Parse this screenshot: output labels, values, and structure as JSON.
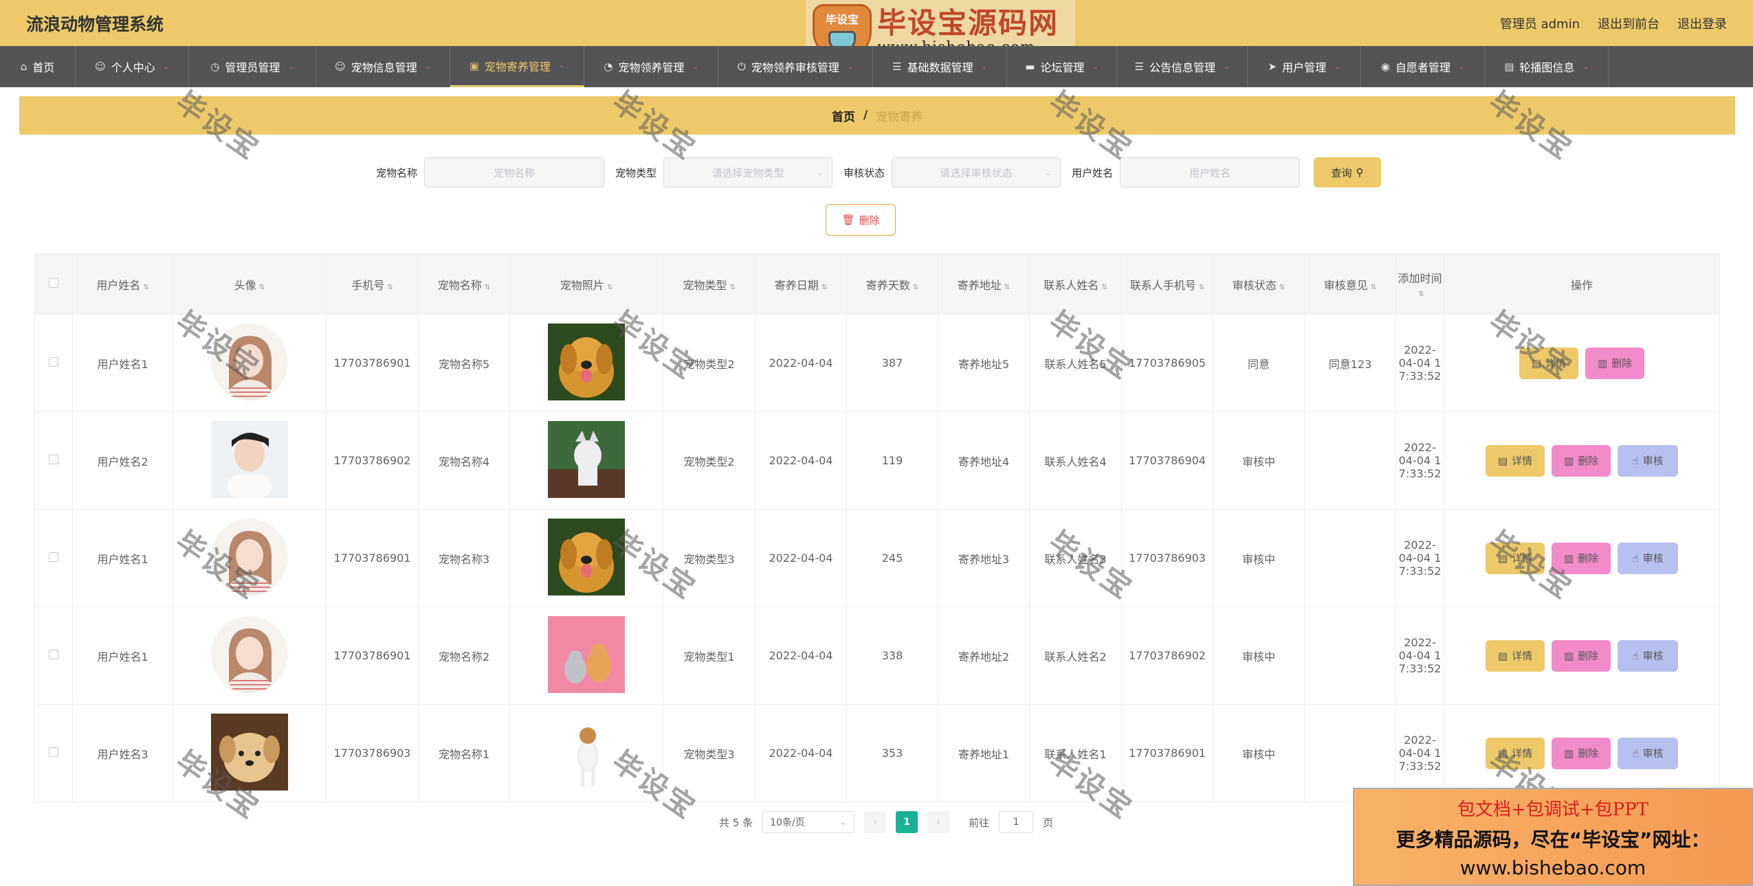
{
  "header": {
    "app_title": "流浪动物管理系统",
    "admin_label": "管理员 admin",
    "front_link": "退出到前台",
    "logout_link": "退出登录"
  },
  "logo_watermark": {
    "badge_text": "毕设宝",
    "title": "毕设宝源码网",
    "url": "www.bishebao.com"
  },
  "nav": {
    "items": [
      {
        "label": "首页",
        "icon": "home-icon"
      },
      {
        "label": "个人中心",
        "icon": "user-icon"
      },
      {
        "label": "管理员管理",
        "icon": "clock-icon"
      },
      {
        "label": "宠物信息管理",
        "icon": "user-icon"
      },
      {
        "label": "宠物寄养管理",
        "icon": "briefcase-icon",
        "active": true
      },
      {
        "label": "宠物领养管理",
        "icon": "gauge-icon"
      },
      {
        "label": "宠物领养审核管理",
        "icon": "power-icon"
      },
      {
        "label": "基础数据管理",
        "icon": "list-icon"
      },
      {
        "label": "论坛管理",
        "icon": "chat-icon"
      },
      {
        "label": "公告信息管理",
        "icon": "list-icon"
      },
      {
        "label": "用户管理",
        "icon": "send-icon"
      },
      {
        "label": "自愿者管理",
        "icon": "location-icon"
      },
      {
        "label": "轮播图信息",
        "icon": "clipboard-icon"
      }
    ]
  },
  "breadcrumb": {
    "home": "首页",
    "separator": "/",
    "current": "宠物寄养"
  },
  "search": {
    "pet_name_label": "宠物名称",
    "pet_name_placeholder": "宠物名称",
    "pet_type_label": "宠物类型",
    "pet_type_placeholder": "请选择宠物类型",
    "audit_label": "审核状态",
    "audit_placeholder": "请选择审核状态",
    "user_name_label": "用户姓名",
    "user_name_placeholder": "用户姓名",
    "query_button": "查询"
  },
  "batch_delete_button": "删除",
  "table": {
    "columns": [
      "用户姓名",
      "头像",
      "手机号",
      "宠物名称",
      "宠物照片",
      "宠物类型",
      "寄养日期",
      "寄养天数",
      "寄养地址",
      "联系人姓名",
      "联系人手机号",
      "审核状态",
      "审核意见",
      "添加时间",
      "操作"
    ],
    "rows": [
      {
        "user": "用户姓名1",
        "phone": "17703786901",
        "pet_name": "宠物名称5",
        "pet_type": "宠物类型2",
        "date": "2022-04-04",
        "days": "387",
        "address": "寄养地址5",
        "contact": "联系人姓名5",
        "contact_phone": "17703786905",
        "status": "同意",
        "opinion": "同意123",
        "added_l1": "2022-04-04 1",
        "added_l2": "7:33:52",
        "avatar": "girl",
        "photo": "golden",
        "can_audit": false
      },
      {
        "user": "用户姓名2",
        "phone": "17703786902",
        "pet_name": "宠物名称4",
        "pet_type": "宠物类型2",
        "date": "2022-04-04",
        "days": "119",
        "address": "寄养地址4",
        "contact": "联系人姓名4",
        "contact_phone": "17703786904",
        "status": "审核中",
        "opinion": "",
        "added_l1": "2022-04-04 1",
        "added_l2": "7:33:52",
        "avatar": "boy",
        "photo": "husky",
        "can_audit": true
      },
      {
        "user": "用户姓名1",
        "phone": "17703786901",
        "pet_name": "宠物名称3",
        "pet_type": "宠物类型3",
        "date": "2022-04-04",
        "days": "245",
        "address": "寄养地址3",
        "contact": "联系人姓名3",
        "contact_phone": "17703786903",
        "status": "审核中",
        "opinion": "",
        "added_l1": "2022-04-04 1",
        "added_l2": "7:33:52",
        "avatar": "girl",
        "photo": "golden",
        "can_audit": true
      },
      {
        "user": "用户姓名1",
        "phone": "17703786901",
        "pet_name": "宠物名称2",
        "pet_type": "宠物类型1",
        "date": "2022-04-04",
        "days": "338",
        "address": "寄养地址2",
        "contact": "联系人姓名2",
        "contact_phone": "17703786902",
        "status": "审核中",
        "opinion": "",
        "added_l1": "2022-04-04 1",
        "added_l2": "7:33:52",
        "avatar": "girl",
        "photo": "pink",
        "can_audit": true
      },
      {
        "user": "用户姓名3",
        "phone": "17703786903",
        "pet_name": "宠物名称1",
        "pet_type": "宠物类型3",
        "date": "2022-04-04",
        "days": "353",
        "address": "寄养地址1",
        "contact": "联系人姓名1",
        "contact_phone": "17703786901",
        "status": "审核中",
        "opinion": "",
        "added_l1": "2022-04-04 1",
        "added_l2": "7:33:52",
        "avatar": "puppy",
        "photo": "jack",
        "can_audit": true
      }
    ],
    "op_detail": "详情",
    "op_delete": "删除",
    "op_audit": "审核"
  },
  "pagination": {
    "total": "共 5 条",
    "page_size": "10条/页",
    "current_page": "1",
    "goto_label": "前往",
    "goto_value": "1",
    "page_suffix": "页"
  },
  "watermark_text": "毕设宝",
  "promo": {
    "line1": "包文档+包调试+包PPT",
    "line2": "更多精品源码，尽在“毕设宝”网址：",
    "line3": "www.bishebao.com"
  }
}
